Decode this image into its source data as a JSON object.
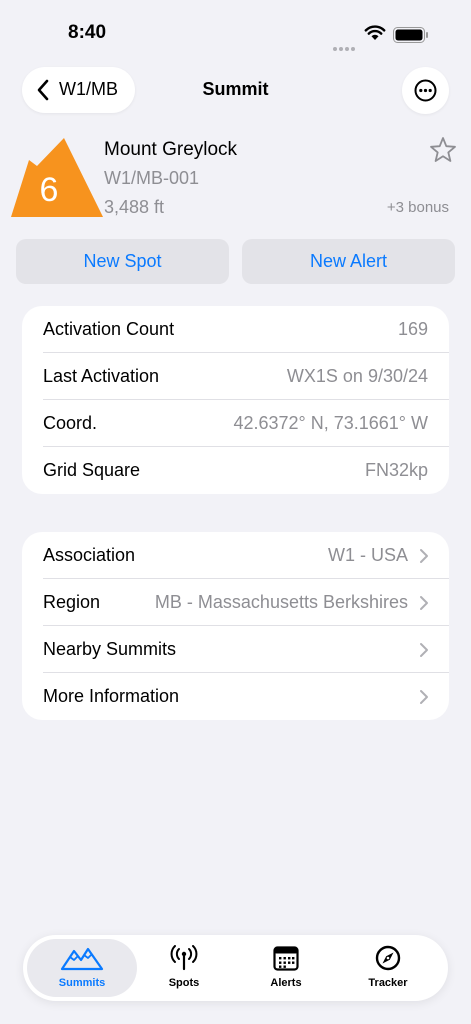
{
  "status_bar": {
    "time": "8:40"
  },
  "nav": {
    "back_label": "W1/MB",
    "title": "Summit"
  },
  "summit": {
    "points": "6",
    "name": "Mount Greylock",
    "code": "W1/MB-001",
    "elevation": "3,488 ft",
    "bonus": "+3 bonus",
    "badge_color": "#f7931e"
  },
  "actions": {
    "new_spot": "New Spot",
    "new_alert": "New Alert"
  },
  "details": [
    {
      "label": "Activation Count",
      "value": "169"
    },
    {
      "label": "Last Activation",
      "value": "WX1S on 9/30/24"
    },
    {
      "label": "Coord.",
      "value": "42.6372° N, 73.1661° W"
    },
    {
      "label": "Grid Square",
      "value": "FN32kp"
    }
  ],
  "links": [
    {
      "label": "Association",
      "value": "W1 - USA"
    },
    {
      "label": "Region",
      "value": "MB - Massachusetts Berkshires"
    },
    {
      "label": "Nearby Summits",
      "value": ""
    },
    {
      "label": "More Information",
      "value": ""
    }
  ],
  "tabs": [
    {
      "label": "Summits",
      "icon": "mountains-icon",
      "active": true
    },
    {
      "label": "Spots",
      "icon": "antenna-icon",
      "active": false
    },
    {
      "label": "Alerts",
      "icon": "calendar-icon",
      "active": false
    },
    {
      "label": "Tracker",
      "icon": "compass-icon",
      "active": false
    }
  ],
  "colors": {
    "accent": "#0a7aff",
    "background": "#f2f2f7"
  }
}
